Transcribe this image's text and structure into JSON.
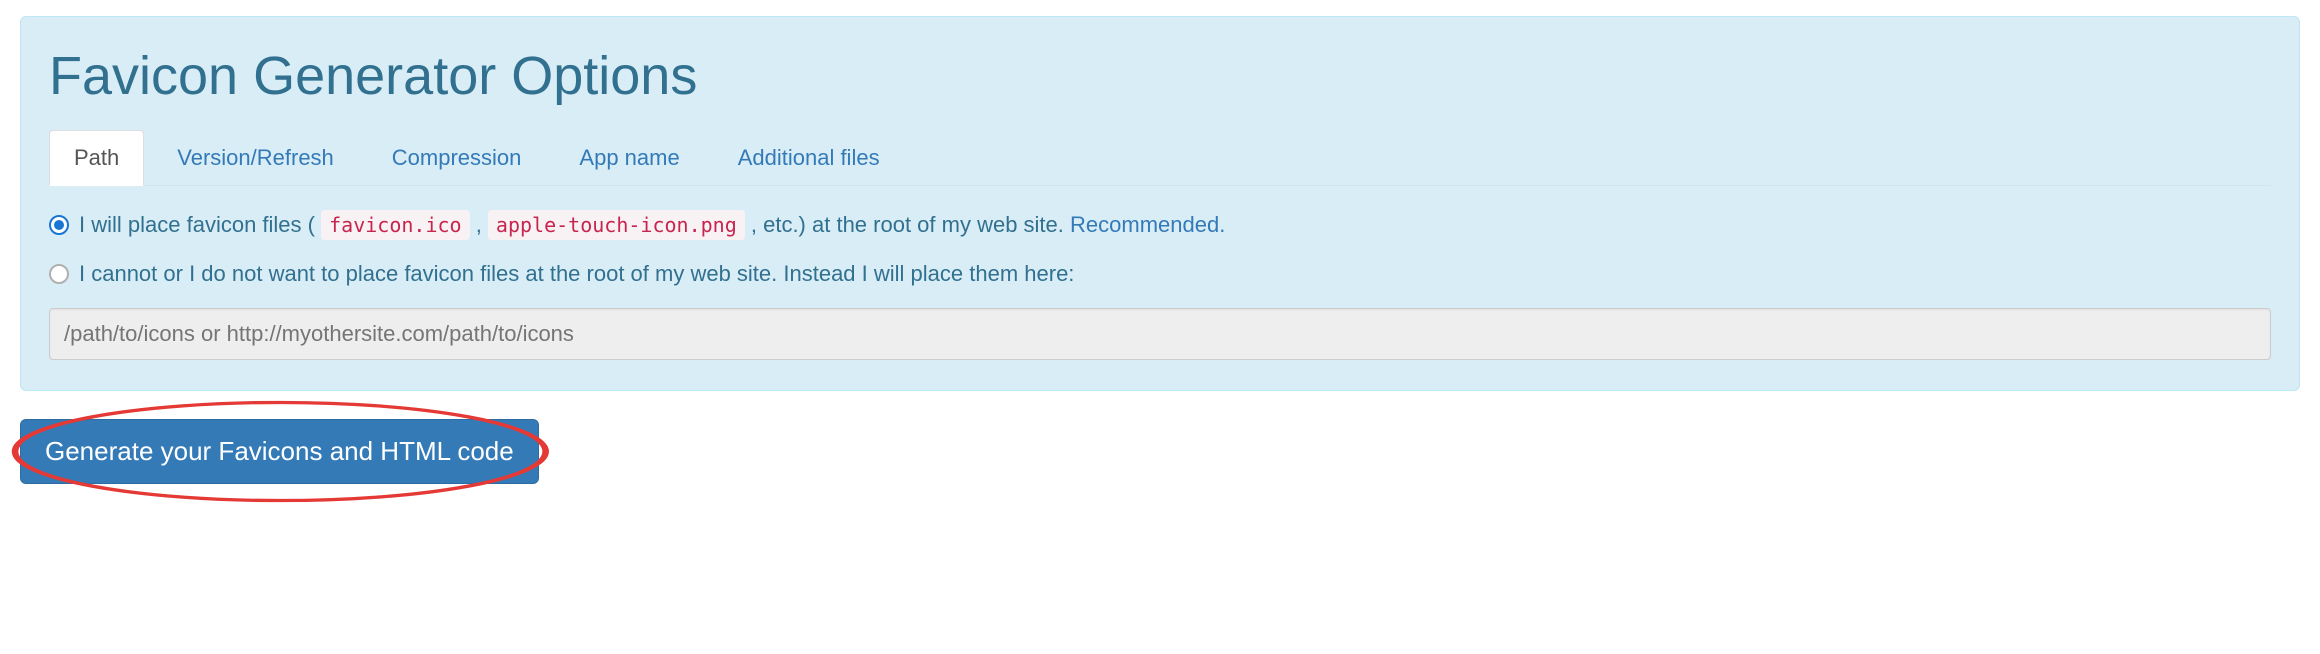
{
  "panel": {
    "title": "Favicon Generator Options"
  },
  "tabs": [
    {
      "label": "Path",
      "active": true
    },
    {
      "label": "Version/Refresh",
      "active": false
    },
    {
      "label": "Compression",
      "active": false
    },
    {
      "label": "App name",
      "active": false
    },
    {
      "label": "Additional files",
      "active": false
    }
  ],
  "option_root": {
    "pre": "I will place favicon files (",
    "code1": "favicon.ico",
    "sep": " , ",
    "code2": "apple-touch-icon.png",
    "post": " , etc.) at the root of my web site. ",
    "rec": "Recommended.",
    "checked": true
  },
  "option_custom": {
    "label": "I cannot or I do not want to place favicon files at the root of my web site. Instead I will place them here:",
    "checked": false
  },
  "path_input": {
    "placeholder": "/path/to/icons or http://myothersite.com/path/to/icons",
    "value": ""
  },
  "generate_button": {
    "label": "Generate your Favicons and HTML code"
  }
}
